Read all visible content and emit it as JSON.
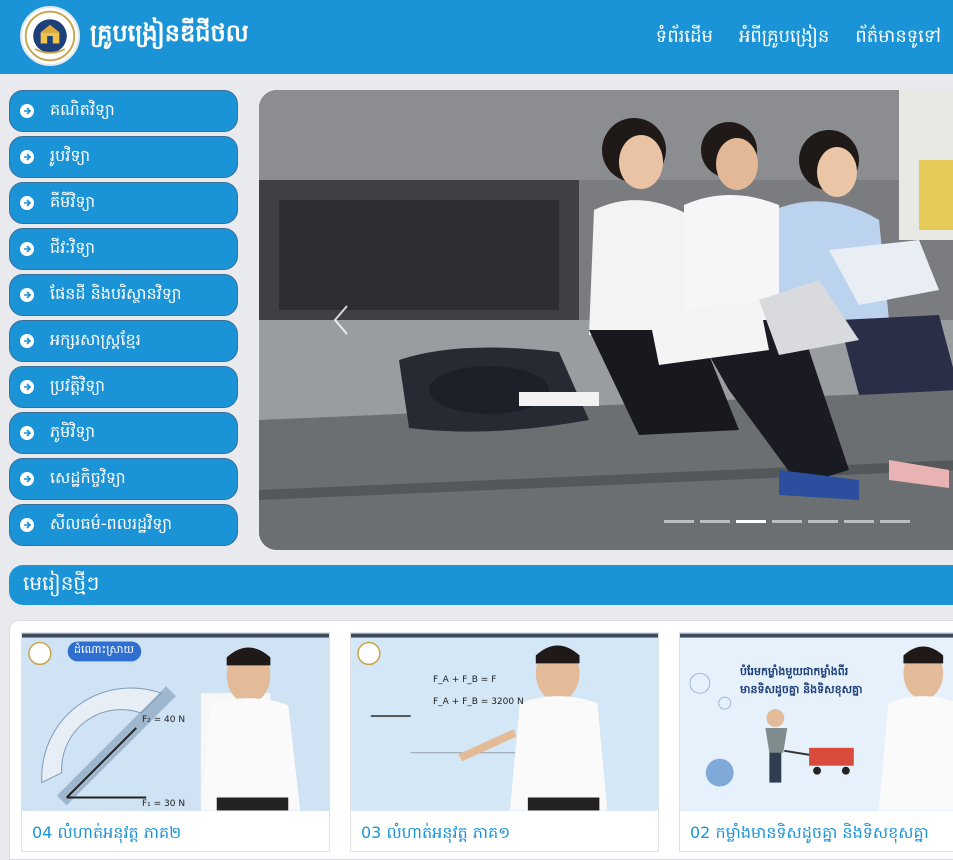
{
  "header": {
    "brand": "គ្រូបង្រៀនឌីជីថល",
    "nav": [
      "ទំព័រដើម",
      "អំពីគ្រូបង្រៀន",
      "ព័ត៌មានទូទៅ"
    ]
  },
  "sidebar": {
    "items": [
      {
        "label": "គណិតវិទ្យា"
      },
      {
        "label": "រូបវិទ្យា"
      },
      {
        "label": "គីមីវិទ្យា"
      },
      {
        "label": "ជីវៈវិទ្យា"
      },
      {
        "label": "ផែនដី និងបរិស្ថានវិទ្យា"
      },
      {
        "label": "អក្សរសាស្រ្តខ្មែរ"
      },
      {
        "label": "ប្រវត្តិវិទ្យា"
      },
      {
        "label": "ភូមិវិទ្យា"
      },
      {
        "label": "សេដ្ឋកិច្ចវិទ្យា"
      },
      {
        "label": "សីលធម៌-ពលរដ្ឋវិទ្យា"
      }
    ]
  },
  "slider": {
    "slide_count": 7,
    "active_index": 2
  },
  "section": {
    "title": "មេរៀនថ្មីៗ"
  },
  "cards": [
    {
      "title": "04 លំហាត់អនុវត្ត ភាគ២",
      "badge": "ដំណោះស្រាយ",
      "eq1": "F₂ = 40 N",
      "eq2": "F₁ = 30 N"
    },
    {
      "title": "03 លំហាត់អនុវត្ត ភាគ១",
      "eq1": "F_A + F_B = F",
      "eq2": "F_A + F_B = 3200 N"
    },
    {
      "title": "02 កម្លាំងមានទិសដូចគ្នា និងទិសខុសគ្នា",
      "heading1": "បំរែមកម្លាំងមួយជាកម្លាំងពីរ",
      "heading2": "មានទិសដូចគ្នា និងទិសខុសគ្នា"
    }
  ],
  "colors": {
    "primary": "#1b93d7",
    "border": "#3b6f98"
  }
}
